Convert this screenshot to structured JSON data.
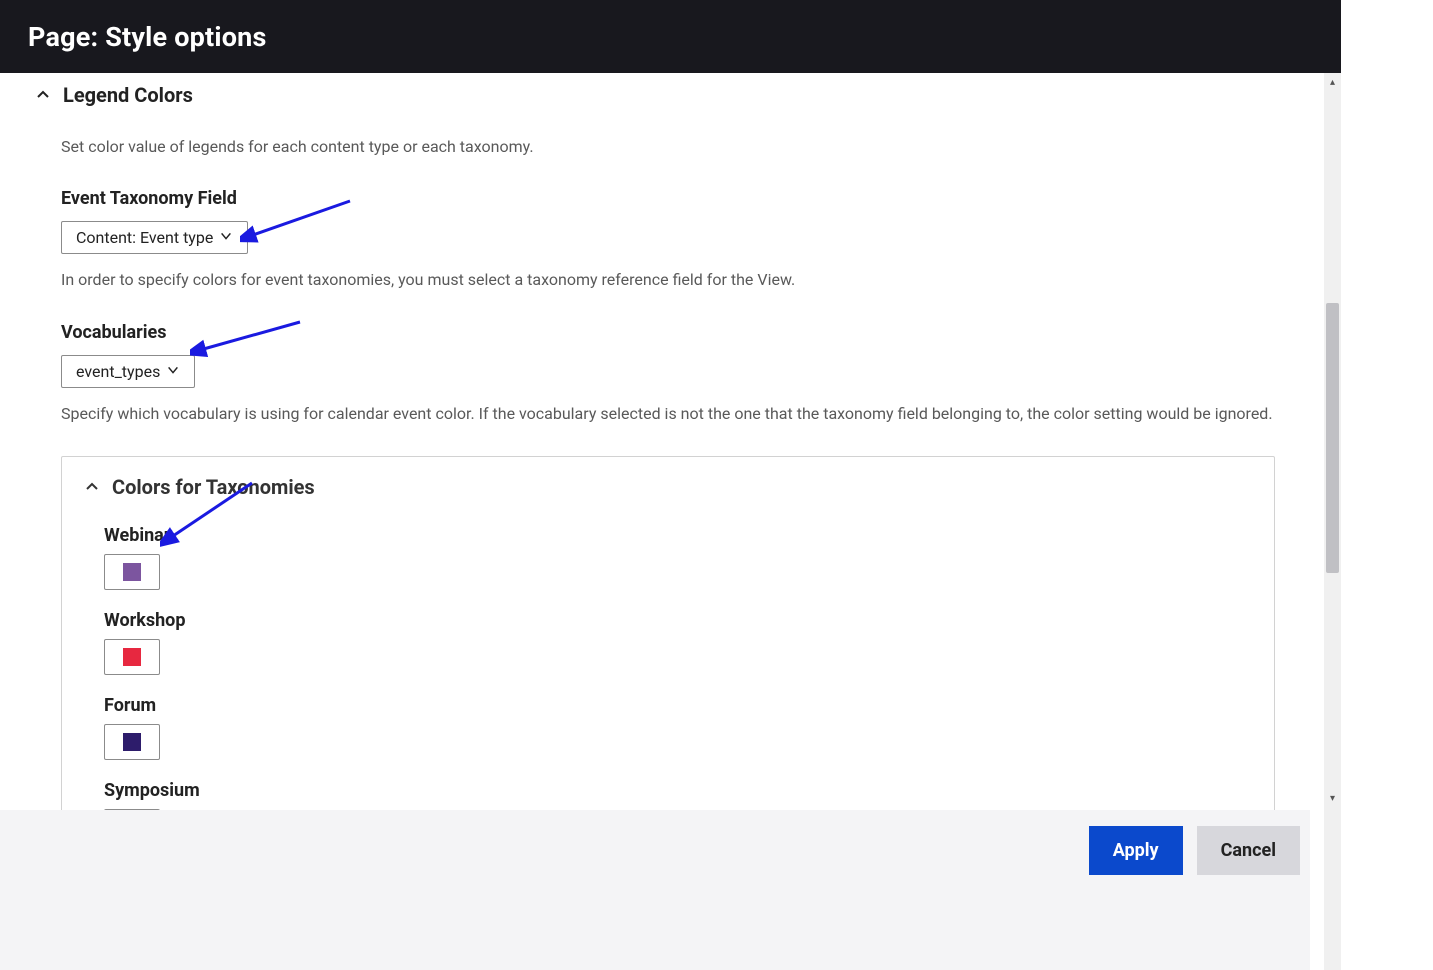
{
  "header": {
    "title": "Page: Style options"
  },
  "legend_section": {
    "title": "Legend Colors",
    "description": "Set color value of legends for each content type or each taxonomy.",
    "event_taxonomy_field": {
      "label": "Event Taxonomy Field",
      "value": "Content: Event type",
      "help": "In order to specify colors for event taxonomies, you must select a taxonomy reference field for the View."
    },
    "vocabularies": {
      "label": "Vocabularies",
      "value": "event_types",
      "help": "Specify which vocabulary is using for calendar event color. If the vocabulary selected is not the one that the taxonomy field belonging to, the color setting would be ignored."
    },
    "colors_for_taxonomies": {
      "title": "Colors for Taxonomies",
      "items": [
        {
          "label": "Webinar",
          "color": "#7c559f"
        },
        {
          "label": "Workshop",
          "color": "#e72840"
        },
        {
          "label": "Forum",
          "color": "#2d1c6b"
        },
        {
          "label": "Symposium",
          "color": "#542de8"
        }
      ]
    }
  },
  "footer": {
    "apply_label": "Apply",
    "cancel_label": "Cancel"
  }
}
